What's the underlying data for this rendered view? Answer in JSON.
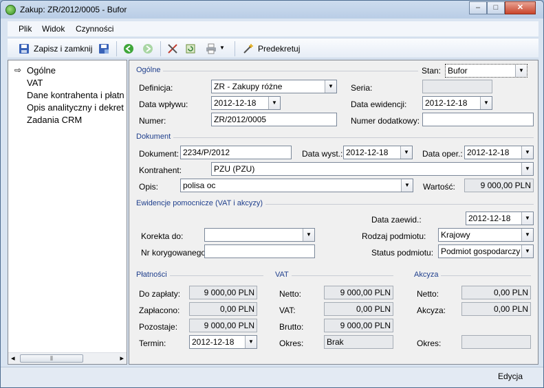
{
  "window": {
    "title": "Zakup: ZR/2012/0005 - Bufor",
    "btn_min": "–",
    "btn_max": "□",
    "btn_close": "✕"
  },
  "menu": [
    "Plik",
    "Widok",
    "Czynności"
  ],
  "toolbar": {
    "save_close": "Zapisz i zamknij",
    "predekretuj": "Predekretuj"
  },
  "tree": [
    "Ogólne",
    "VAT",
    "Dane kontrahenta i płatn",
    "Opis analityczny i dekret",
    "Zadania CRM"
  ],
  "tree_arrow": "⇨",
  "scroll": {
    "left": "◂",
    "grip": "⦀",
    "right": "▸"
  },
  "ogolne": {
    "section": "Ogólne",
    "stan_label": "Stan:",
    "stan_value": "Bufor",
    "definicja_label": "Definicja:",
    "definicja_value": "ZR - Zakupy różne",
    "seria_label": "Seria:",
    "data_wplywu_label": "Data wpływu:",
    "data_wplywu_value": "2012-12-18",
    "data_ewidencji_label": "Data ewidencji:",
    "data_ewidencji_value": "2012-12-18",
    "numer_label": "Numer:",
    "numer_value": "ZR/2012/0005",
    "numer_dod_label": "Numer dodatkowy:"
  },
  "dokument": {
    "section": "Dokument",
    "dokument_label": "Dokument:",
    "dokument_value": "2234/P/2012",
    "data_wyst_label": "Data wyst.:",
    "data_wyst_value": "2012-12-18",
    "data_oper_label": "Data oper.:",
    "data_oper_value": "2012-12-18",
    "kontrahent_label": "Kontrahent:",
    "kontrahent_value": "PZU (PZU)",
    "opis_label": "Opis:",
    "opis_value": "polisa oc",
    "wartosc_label": "Wartość:",
    "wartosc_value": "9 000,00 PLN"
  },
  "ewidencje": {
    "section": "Ewidencje pomocnicze (VAT i akcyzy)",
    "data_zaewid_label": "Data zaewid.:",
    "data_zaewid_value": "2012-12-18",
    "korekta_label": "Korekta do:",
    "korekta_value": "",
    "rodzaj_label": "Rodzaj podmiotu:",
    "rodzaj_value": "Krajowy",
    "nr_kor_label": "Nr korygowanego:",
    "status_label": "Status podmiotu:",
    "status_value": "Podmiot gospodarczy"
  },
  "platnosci": {
    "section": "Płatności",
    "do_zaplaty_label": "Do zapłaty:",
    "do_zaplaty_value": "9 000,00 PLN",
    "zaplacono_label": "Zapłacono:",
    "zaplacono_value": "0,00 PLN",
    "pozostaje_label": "Pozostaje:",
    "pozostaje_value": "9 000,00 PLN",
    "termin_label": "Termin:",
    "termin_value": "2012-12-18"
  },
  "vat": {
    "section": "VAT",
    "netto_label": "Netto:",
    "netto_value": "9 000,00 PLN",
    "vat_label": "VAT:",
    "vat_value": "0,00 PLN",
    "brutto_label": "Brutto:",
    "brutto_value": "9 000,00 PLN",
    "okres_label": "Okres:",
    "okres_value": "Brak"
  },
  "akcyza": {
    "section": "Akcyza",
    "netto_label": "Netto:",
    "netto_value": "0,00 PLN",
    "akcyza_label": "Akcyza:",
    "akcyza_value": "0,00 PLN",
    "okres_label": "Okres:",
    "okres_value": ""
  },
  "status": {
    "mode": "Edycja"
  },
  "dropdown_glyph": "▼"
}
